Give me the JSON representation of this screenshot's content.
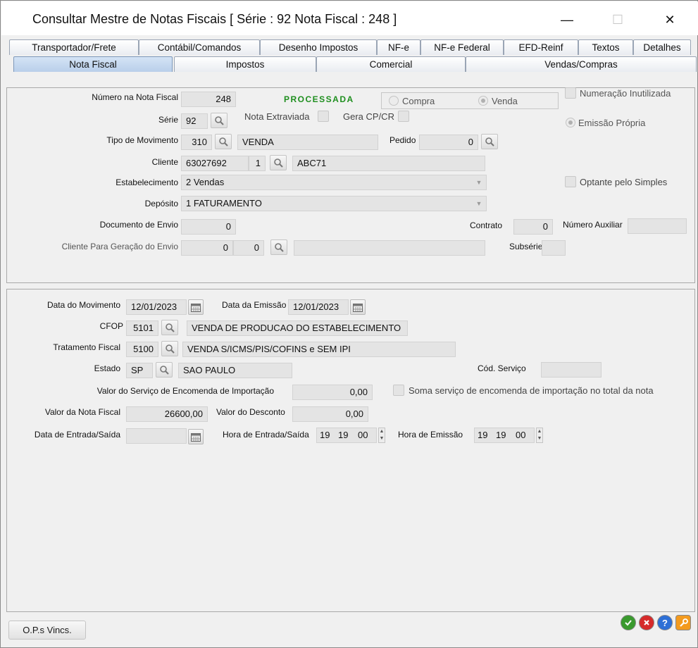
{
  "window": {
    "title": "Consultar Mestre de Notas Fiscais [ Série : 92  Nota Fiscal : 248 ]",
    "minimize": "—",
    "maximize": "☐",
    "close": "✕"
  },
  "tabs_top": [
    "Transportador/Frete",
    "Contábil/Comandos",
    "Desenho Impostos",
    "NF-e",
    "NF-e Federal",
    "EFD-Reinf",
    "Textos",
    "Detalhes"
  ],
  "tabs_bottom": [
    "Nota Fiscal",
    "Impostos",
    "Comercial",
    "Vendas/Compras"
  ],
  "active_tab": "Nota Fiscal",
  "section1": {
    "numero_nf": {
      "label": "Número na Nota Fiscal",
      "value": "248"
    },
    "status": "PROCESSADA",
    "tipo_op": {
      "compra": "Compra",
      "venda": "Venda",
      "selected": "Venda"
    },
    "numeracao_inutilizada": "Numeração Inutilizada",
    "serie": {
      "label": "Série",
      "value": "92"
    },
    "nota_extraviada": "Nota Extraviada",
    "gera_cp_cr": "Gera CP/CR",
    "emissao_propria": "Emissão Própria",
    "tipo_movimento": {
      "label": "Tipo de Movimento",
      "code": "310",
      "desc": "VENDA"
    },
    "pedido": {
      "label": "Pedido",
      "value": "0"
    },
    "cliente": {
      "label": "Cliente",
      "code": "63027692",
      "seq": "1",
      "name": "ABC71"
    },
    "estabelecimento": {
      "label": "Estabelecimento",
      "value": "2 Vendas"
    },
    "optante_simples": "Optante pelo Simples",
    "deposito": {
      "label": "Depósito",
      "value": "1 FATURAMENTO"
    },
    "documento_envio": {
      "label": "Documento de Envio",
      "value": "0"
    },
    "contrato": {
      "label": "Contrato",
      "value": "0"
    },
    "numero_auxiliar": {
      "label": "Número Auxiliar",
      "value": ""
    },
    "cliente_envio": {
      "label": "Cliente Para Geração do Envio",
      "code": "0",
      "seq": "0",
      "name": ""
    },
    "subserie": {
      "label": "Subsérie",
      "value": ""
    }
  },
  "section2": {
    "data_movimento": {
      "label": "Data do Movimento",
      "value": "12/01/2023"
    },
    "data_emissao": {
      "label": "Data da Emissão",
      "value": "12/01/2023"
    },
    "cfop": {
      "label": "CFOP",
      "code": "5101",
      "desc": "VENDA DE PRODUCAO DO ESTABELECIMENTO"
    },
    "tratamento_fiscal": {
      "label": "Tratamento Fiscal",
      "code": "5100",
      "desc": "VENDA S/ICMS/PIS/COFINS e SEM IPI"
    },
    "estado": {
      "label": "Estado",
      "code": "SP",
      "desc": "SAO PAULO"
    },
    "cod_servico": {
      "label": "Cód. Serviço",
      "value": ""
    },
    "valor_servico_encomenda": {
      "label": "Valor do Serviço de Encomenda de Importação",
      "value": "0,00"
    },
    "soma_servico": "Soma serviço de encomenda de importação no total da nota",
    "valor_nf": {
      "label": "Valor da Nota Fiscal",
      "value": "26600,00"
    },
    "valor_desconto": {
      "label": "Valor do Desconto",
      "value": "0,00"
    },
    "data_entrada_saida": {
      "label": "Data de Entrada/Saída",
      "value": ""
    },
    "hora_entrada_saida": {
      "label": "Hora de Entrada/Saída",
      "h": "19",
      "m": "19",
      "s": "00"
    },
    "hora_emissao": {
      "label": "Hora de Emissão",
      "h": "19",
      "m": "19",
      "s": "00"
    }
  },
  "footer": {
    "ops_button": "O.P.s Vincs.",
    "actions": [
      "confirm-icon",
      "cancel-icon",
      "help-icon",
      "tools-icon"
    ]
  }
}
